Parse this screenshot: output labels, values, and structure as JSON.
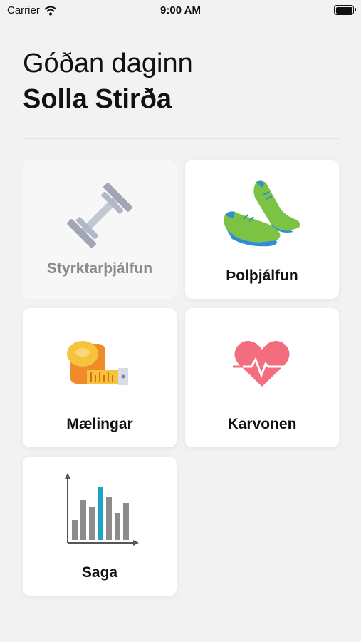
{
  "status_bar": {
    "carrier": "Carrier",
    "time": "9:00 AM",
    "wifi_icon": "wifi-icon",
    "battery_icon": "battery-icon"
  },
  "header": {
    "greeting": "Góðan daginn",
    "name": "Solla Stirða"
  },
  "tiles": [
    {
      "label": "Styrktarþjálfun",
      "icon": "dumbbell-icon",
      "enabled": false
    },
    {
      "label": "Þolþjálfun",
      "icon": "running-shoes-icon",
      "enabled": true
    },
    {
      "label": "Mælingar",
      "icon": "measuring-tape-icon",
      "enabled": true
    },
    {
      "label": "Karvonen",
      "icon": "heart-pulse-icon",
      "enabled": true
    },
    {
      "label": "Saga",
      "icon": "bar-chart-icon",
      "enabled": true
    }
  ],
  "colors": {
    "background": "#f2f2f2",
    "tile": "#ffffff",
    "disabled_label": "#8a8a8a",
    "shoe_green": "#7cc243",
    "shoe_blue": "#2f8fd1",
    "tape_yellow": "#f6c33c",
    "tape_orange": "#f08a2a",
    "heart_pink": "#f26d7d",
    "chart_teal": "#1ba4c4",
    "chart_gray": "#8c8c8c"
  }
}
